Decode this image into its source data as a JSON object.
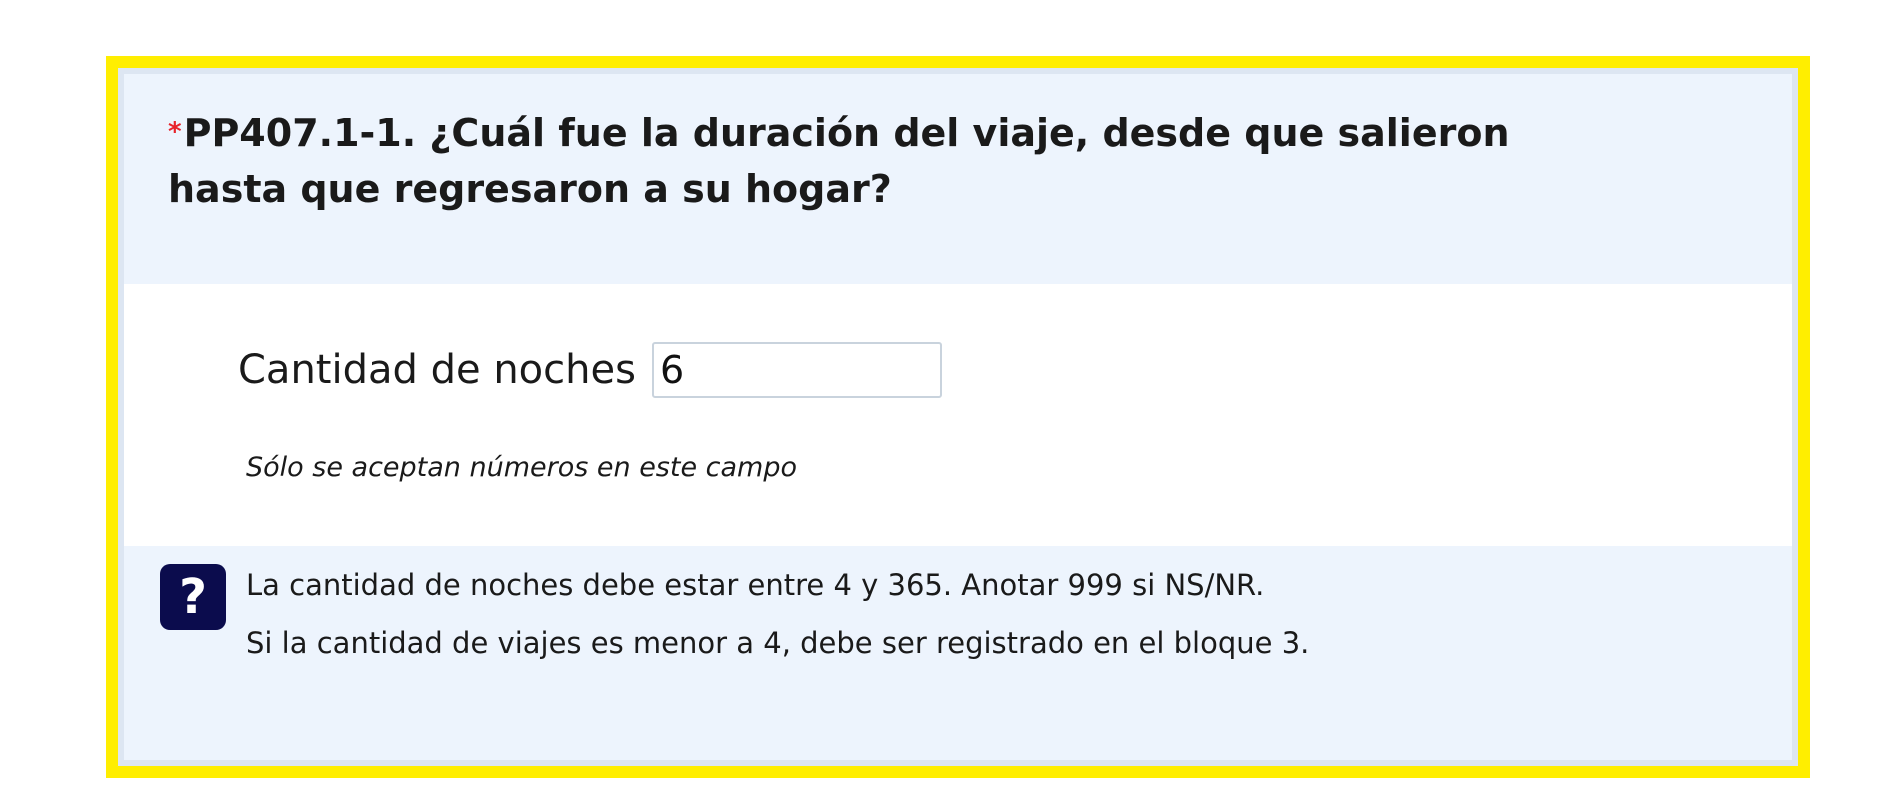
{
  "question": {
    "required_marker": "*",
    "title": "PP407.1-1. ¿Cuál fue la duración del viaje, desde que salieron hasta que regresaron a su hogar?"
  },
  "answer": {
    "label": "Cantidad de noches",
    "value": "6",
    "hint": "Sólo se aceptan números en este campo"
  },
  "help": {
    "icon": "question-mark-icon",
    "icon_glyph": "?",
    "lines": [
      "La cantidad de noches debe estar entre 4 y 365. Anotar 999 si NS/NR.",
      "Si la cantidad de viajes es menor a 4, debe ser registrado en el bloque 3."
    ]
  },
  "colors": {
    "highlight_border": "#ffee00",
    "panel_background": "#edf4fd",
    "required_marker": "#e8232b",
    "help_icon_background": "#0b0c4d"
  }
}
